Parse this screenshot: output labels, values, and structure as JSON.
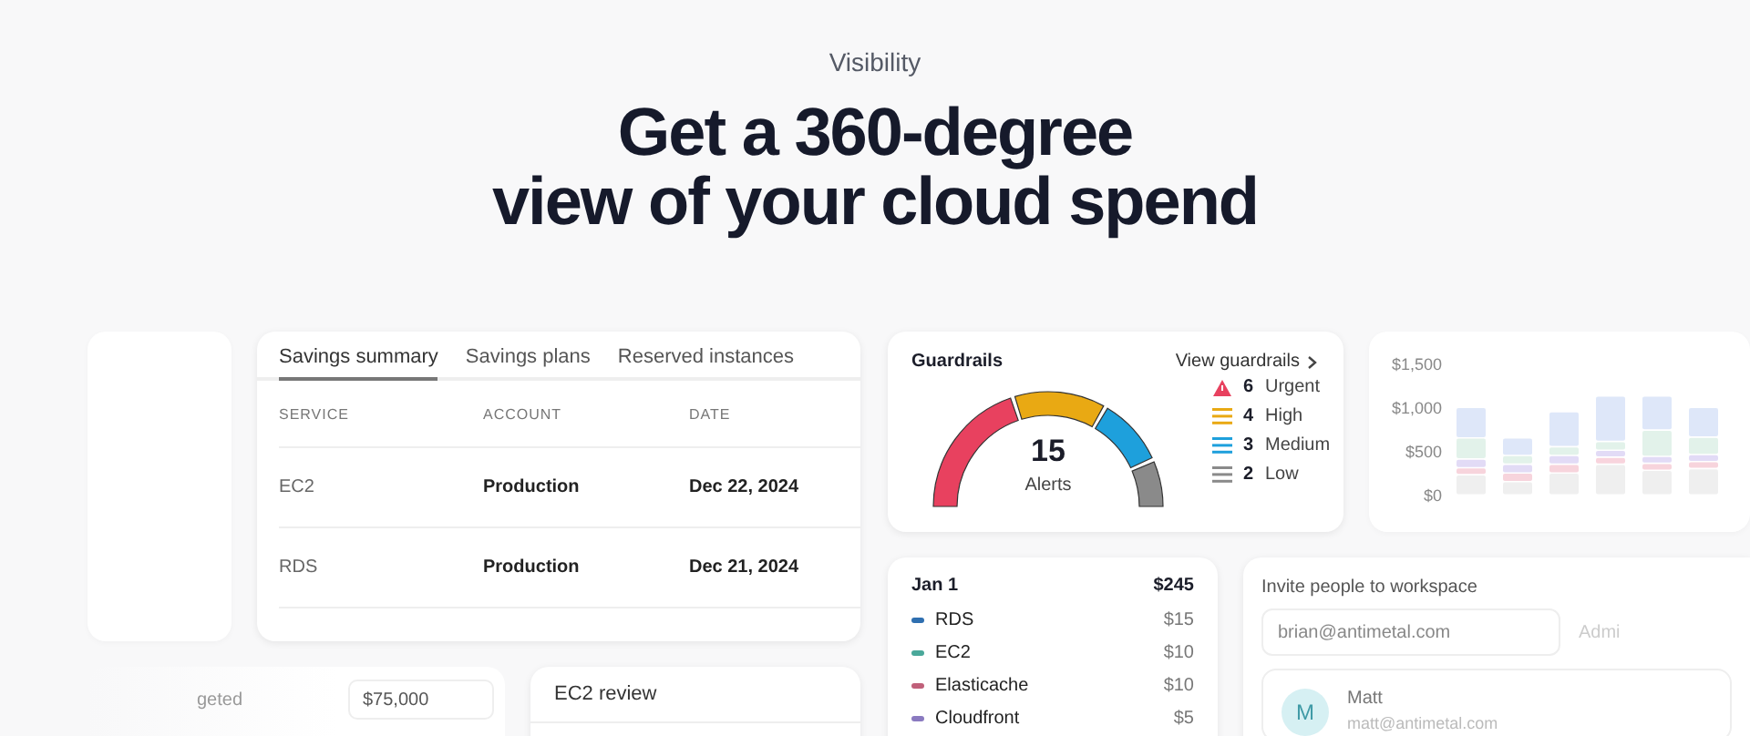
{
  "hero": {
    "eyebrow": "Visibility",
    "title_lines": [
      "Get a 360-degree",
      "view of your cloud spend"
    ]
  },
  "savings": {
    "tabs": [
      {
        "label": "Savings summary",
        "selected": true
      },
      {
        "label": "Savings plans",
        "selected": false
      },
      {
        "label": "Reserved instances",
        "selected": false
      }
    ],
    "columns": [
      "SERVICE",
      "ACCOUNT",
      "DATE"
    ],
    "rows": [
      [
        "EC2",
        "Production",
        "Dec 22, 2024"
      ],
      [
        "RDS",
        "Production",
        "Dec 21, 2024"
      ]
    ]
  },
  "guardrails": {
    "title": "Guardrails",
    "link": "View guardrails",
    "total": "15",
    "total_label": "Alerts",
    "levels": [
      {
        "kind": "triangle",
        "count": "6",
        "label": "Urgent",
        "color": "#e8415f"
      },
      {
        "kind": "lines",
        "count": "4",
        "label": "High",
        "color": "#e9a913"
      },
      {
        "kind": "lines",
        "count": "3",
        "label": "Medium",
        "color": "#1ea0dc"
      },
      {
        "kind": "lines",
        "count": "2",
        "label": "Low",
        "color": "#8a8a8a"
      }
    ]
  },
  "spend_chart": {
    "chart_data": {
      "type": "bar",
      "stacked": true,
      "yticks": [
        {
          "value": 0,
          "label": "$0"
        },
        {
          "value": 500,
          "label": "$500"
        },
        {
          "value": 1000,
          "label": "$1,000"
        },
        {
          "value": 1500,
          "label": "$1,500"
        }
      ],
      "ylim": [
        0,
        1500
      ],
      "series": [
        {
          "color": "#e6e6e6",
          "values": [
            230,
            150,
            250,
            350,
            280,
            300
          ]
        },
        {
          "color": "#f3b8c6",
          "values": [
            80,
            100,
            100,
            80,
            80,
            80
          ]
        },
        {
          "color": "#cfc4f0",
          "values": [
            100,
            100,
            100,
            80,
            80,
            80
          ]
        },
        {
          "color": "#cfeadd",
          "values": [
            240,
            100,
            100,
            100,
            300,
            200
          ]
        },
        {
          "color": "#c9d8f5",
          "values": [
            350,
            200,
            400,
            520,
            390,
            340
          ]
        }
      ]
    }
  },
  "day": {
    "date": "Jan 1",
    "total": "$245",
    "items": [
      {
        "name": "RDS",
        "amount": "$15",
        "color": "#2f6fb0"
      },
      {
        "name": "EC2",
        "amount": "$10",
        "color": "#4aa89a"
      },
      {
        "name": "Elasticache",
        "amount": "$10",
        "color": "#c0607a"
      },
      {
        "name": "Cloudfront",
        "amount": "$5",
        "color": "#8a7ac0"
      }
    ]
  },
  "invite": {
    "title": "Invite people to workspace",
    "placeholder": "brian@antimetal.com",
    "role": "Admi",
    "member": {
      "initial": "M",
      "name": "Matt",
      "email": "matt@antimetal.com"
    }
  },
  "budget": {
    "label": "geted",
    "value": "$75,000"
  },
  "review": {
    "title": "EC2 review"
  }
}
